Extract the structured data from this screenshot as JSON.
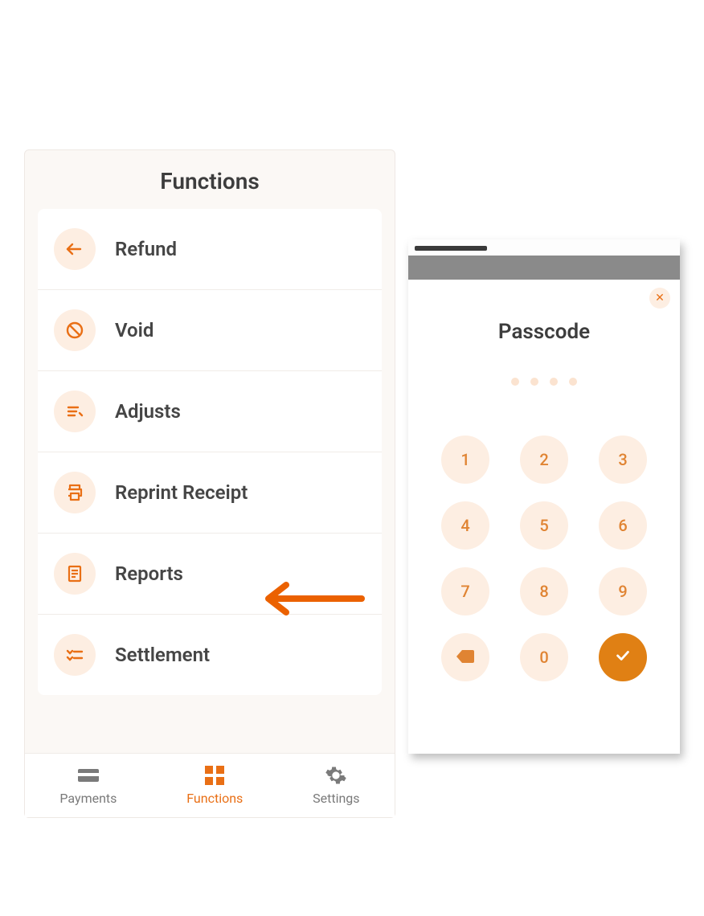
{
  "functions": {
    "title": "Functions",
    "items": [
      {
        "label": "Refund",
        "icon": "refund-icon"
      },
      {
        "label": "Void",
        "icon": "void-icon"
      },
      {
        "label": "Adjusts",
        "icon": "adjust-icon"
      },
      {
        "label": "Reprint Receipt",
        "icon": "print-icon"
      },
      {
        "label": "Reports",
        "icon": "reports-icon"
      },
      {
        "label": "Settlement",
        "icon": "settlement-icon"
      }
    ],
    "nav": [
      {
        "label": "Payments",
        "icon": "payments-icon",
        "active": false
      },
      {
        "label": "Functions",
        "icon": "functions-icon",
        "active": true
      },
      {
        "label": "Settings",
        "icon": "settings-icon",
        "active": false
      }
    ]
  },
  "annotation": {
    "arrow_target": "Reports"
  },
  "passcode": {
    "title": "Passcode",
    "dot_count": 4,
    "keys": [
      "1",
      "2",
      "3",
      "4",
      "5",
      "6",
      "7",
      "8",
      "9",
      "backspace",
      "0",
      "confirm"
    ]
  },
  "colors": {
    "accent": "#e96f15",
    "icon_bg": "#fdeee2"
  }
}
